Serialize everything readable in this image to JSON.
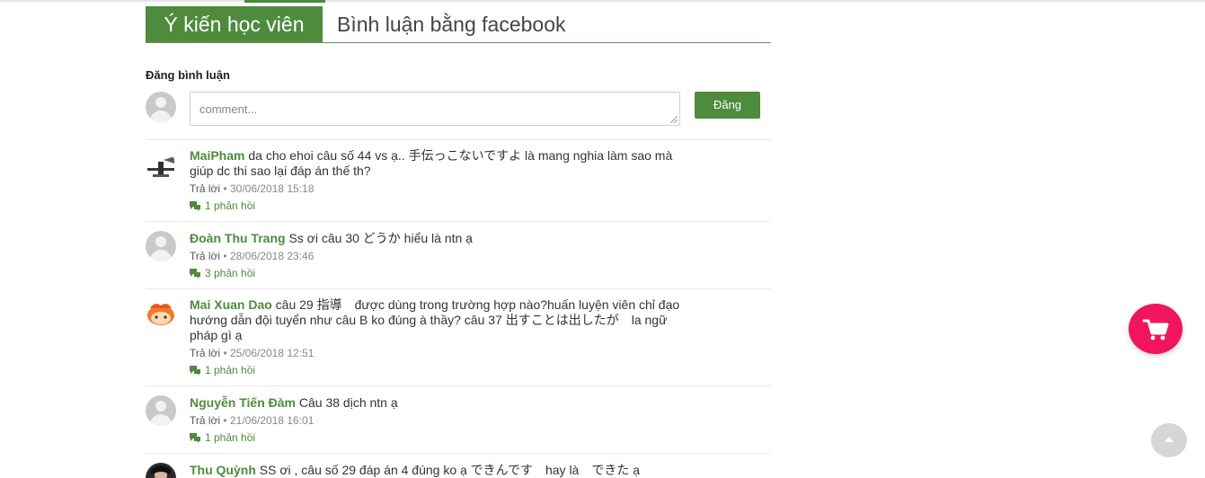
{
  "tabs": {
    "active": "Ý kiến học viên",
    "facebook": "Bình luận bằng facebook"
  },
  "form": {
    "label": "Đăng bình luận",
    "placeholder": "comment...",
    "submit": "Đăng"
  },
  "comments": [
    {
      "author": "MaiPham",
      "text": " da cho ehoi câu số 44 vs ạ.. 手伝っこないですよ là mang nghia làm sao mà giúp dc thi sao lại đáp án thế th?",
      "reply": "Trả lời",
      "date": "30/06/2018 15:18",
      "replies": "1 phản hồi"
    },
    {
      "author": "Đoàn Thu Trang",
      "text": " Ss ơi câu 30 どうか hiểu là ntn ạ",
      "reply": "Trả lời",
      "date": "28/06/2018 23:46",
      "replies": "3 phản hồi"
    },
    {
      "author": "Mai Xuan Dao",
      "text": " câu 29 指導　được dùng trong trường hợp nào?huấn luyện viên chỉ đạo hướng dẫn đội tuyển như câu B ko đúng à thầy? câu 37 出すことは出したが　la ngữ pháp gì ạ",
      "reply": "Trả lời",
      "date": "25/06/2018 12:51",
      "replies": "1 phản hồi"
    },
    {
      "author": "Nguyễn Tiến Đàm",
      "text": " Câu 38 dịch ntn ạ",
      "reply": "Trả lời",
      "date": "21/06/2018 16:01",
      "replies": "1 phản hồi"
    },
    {
      "author": "Thu Quỳnh",
      "text": " SS ơi , câu số 29 đáp án 4 đúng ko ạ できんです　hay là　できた ạ"
    }
  ],
  "meta_separator": " • ",
  "icons": {
    "replies": "comment-icon",
    "cart": "cart-icon",
    "scroll": "arrow-up-icon"
  },
  "colors": {
    "accent": "#4e8b3c",
    "cart": "#f0155e"
  }
}
